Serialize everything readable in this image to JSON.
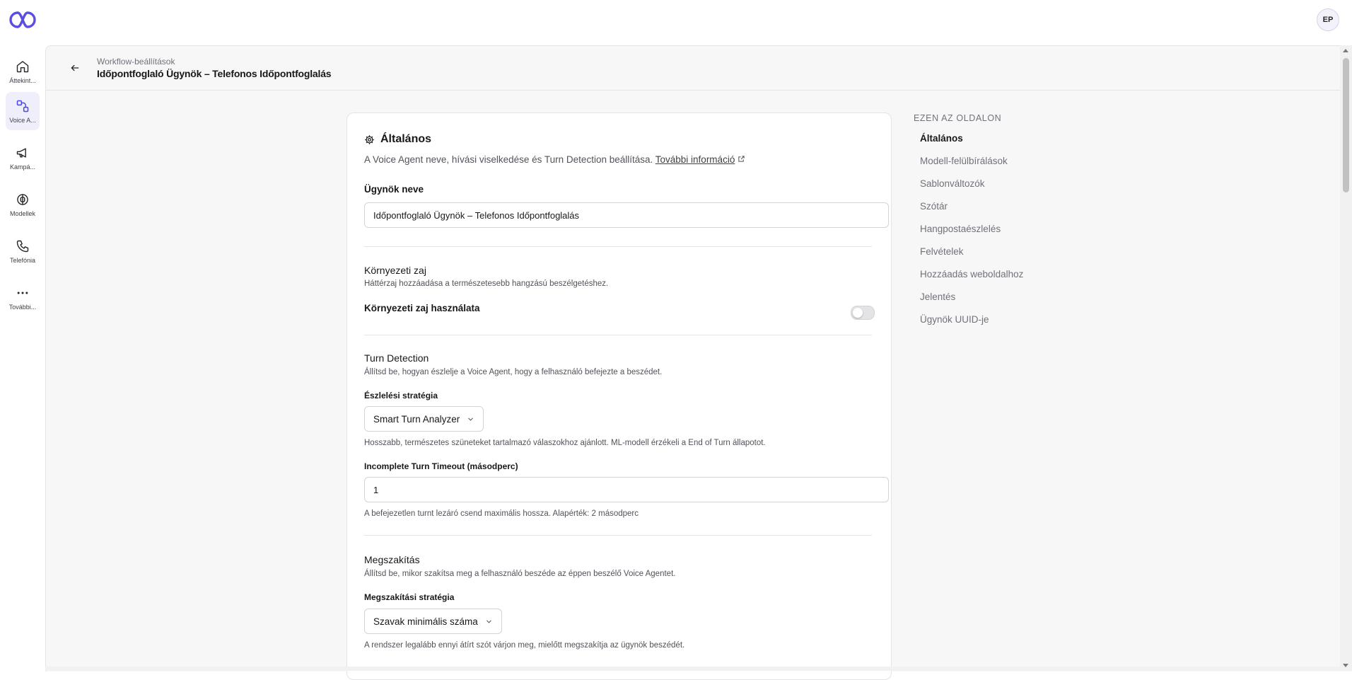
{
  "header": {
    "avatar_initials": "EP"
  },
  "sidebar": {
    "items": [
      {
        "label": "Áttekint...",
        "icon": "home-icon"
      },
      {
        "label": "Voice A...",
        "icon": "workflow-icon",
        "active": true
      },
      {
        "label": "Kampá...",
        "icon": "megaphone-icon"
      },
      {
        "label": "Modellek",
        "icon": "brain-icon"
      },
      {
        "label": "Telefónia",
        "icon": "phone-icon"
      },
      {
        "label": "További...",
        "icon": "more-icon"
      }
    ]
  },
  "breadcrumb": {
    "parent": "Workflow-beállítások",
    "title": "Időpontfoglaló Ügynök – Telefonos Időpontfoglalás"
  },
  "card": {
    "title": "Általános",
    "description": "A Voice Agent neve, hívási viselkedése és Turn Detection beállítása.",
    "more_link": "További információ",
    "agent_name_label": "Ügynök neve",
    "agent_name_value": "Időpontfoglaló Ügynök – Telefonos Időpontfoglalás",
    "ambient": {
      "title": "Környezeti zaj",
      "desc": "Háttérzaj hozzáadása a természetesebb hangzású beszélgetéshez.",
      "toggle_label": "Környezeti zaj használata",
      "enabled": false
    },
    "turn": {
      "title": "Turn Detection",
      "desc": "Állítsd be, hogyan észlelje a Voice Agent, hogy a felhasználó befejezte a beszédet.",
      "strategy_label": "Észlelési stratégia",
      "strategy_value": "Smart Turn Analyzer",
      "strategy_hint": "Hosszabb, természetes szüneteket tartalmazó válaszokhoz ajánlott. ML-modell érzékeli a End of Turn állapotot.",
      "timeout_label": "Incomplete Turn Timeout (másodperc)",
      "timeout_value": "1",
      "timeout_hint": "A befejezetlen turnt lezáró csend maximális hossza. Alapérték: 2 másodperc"
    },
    "interrupt": {
      "title": "Megszakítás",
      "desc": "Állítsd be, mikor szakítsa meg a felhasználó beszéde az éppen beszélő Voice Agentet.",
      "strategy_label": "Megszakítási stratégia",
      "strategy_value": "Szavak minimális száma",
      "strategy_hint": "A rendszer legalább ennyi átírt szót várjon meg, mielőtt megszakítja az ügynök beszédét."
    }
  },
  "toc": {
    "heading": "EZEN AZ OLDALON",
    "items": [
      "Általános",
      "Modell-felülbírálások",
      "Sablonváltozók",
      "Szótár",
      "Hangpostaészlelés",
      "Felvételek",
      "Hozzáadás weboldalhoz",
      "Jelentés",
      "Ügynök UUID-je"
    ]
  },
  "colors": {
    "accent": "#4f46e5",
    "active_nav_bg": "#efeefb"
  }
}
